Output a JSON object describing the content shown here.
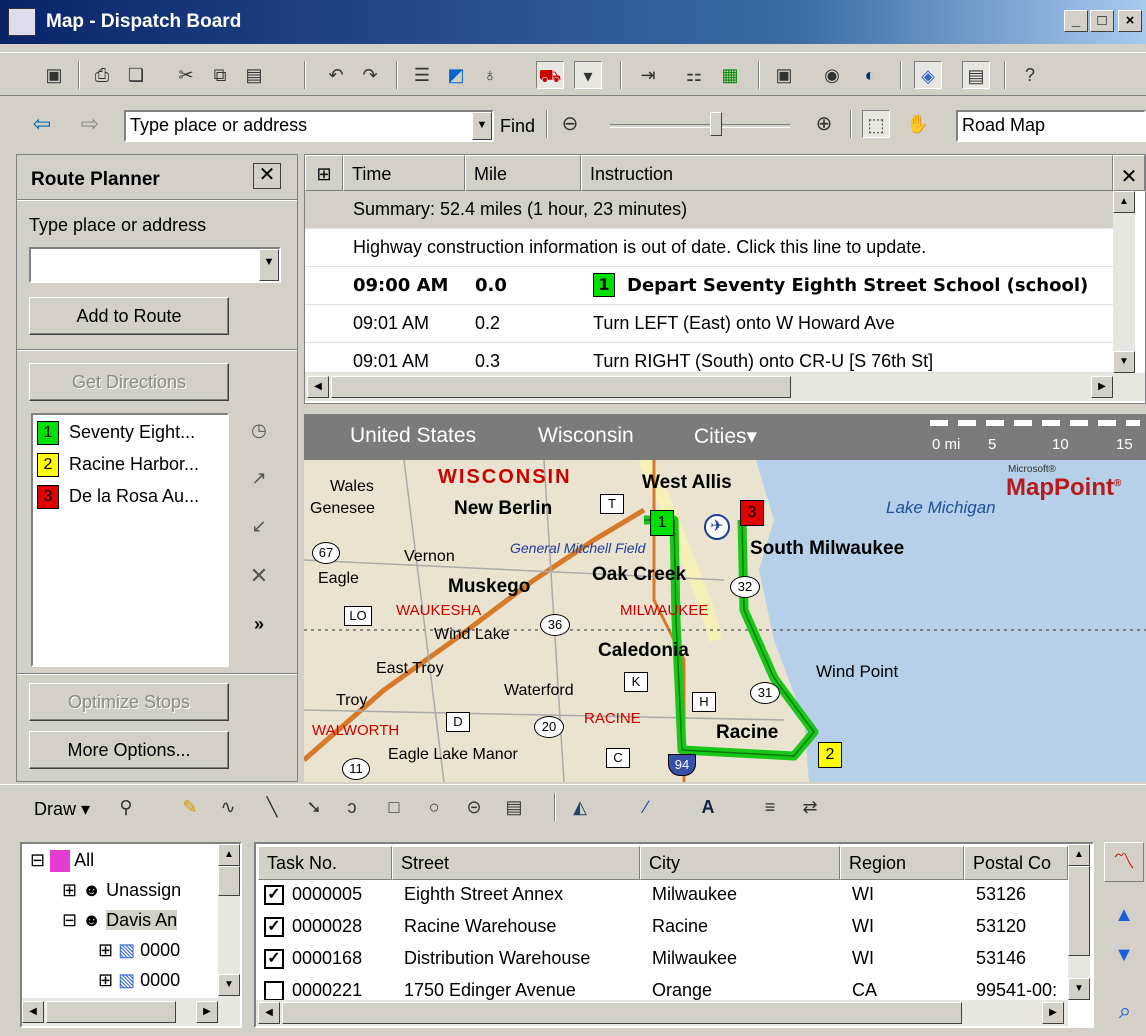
{
  "window": {
    "title": "Map - Dispatch Board"
  },
  "nav": {
    "search_value": "Type place or address",
    "find_label": "Find",
    "map_style": "Road Map"
  },
  "route_planner": {
    "title": "Route Planner",
    "input_label": "Type place or address",
    "input_value": "",
    "add_button": "Add to Route",
    "get_directions": "Get Directions",
    "optimize": "Optimize Stops",
    "more_options": "More Options...",
    "stops": [
      {
        "num": "1",
        "name": "Seventy Eight...",
        "color": "#00e000"
      },
      {
        "num": "2",
        "name": "Racine Harbor...",
        "color": "#ffff00"
      },
      {
        "num": "3",
        "name": "De la Rosa Au...",
        "color": "#e00000"
      }
    ]
  },
  "directions": {
    "headers": {
      "time": "Time",
      "mile": "Mile",
      "instruction": "Instruction"
    },
    "summary": "Summary:  52.4 miles (1 hour, 23 minutes)",
    "notice": "Highway construction information is out of date.  Click this line to update.",
    "rows": [
      {
        "time": "09:00 AM",
        "mile": "0.0",
        "badge": "1",
        "instruction": "Depart Seventy Eighth Street School (school)"
      },
      {
        "time": "09:01 AM",
        "mile": "0.2",
        "instruction": "Turn LEFT (East) onto W Howard Ave"
      },
      {
        "time": "09:01 AM",
        "mile": "0.3",
        "instruction": "Turn RIGHT (South) onto CR-U [S 76th St]"
      }
    ]
  },
  "map": {
    "breadcrumb": [
      "United States",
      "Wisconsin",
      "Cities▾"
    ],
    "scale": [
      "0 mi",
      "5",
      "10",
      "15"
    ],
    "brand_small": "Microsoft®",
    "brand": "MapPoint",
    "brand_mark": "®",
    "labels": {
      "wisconsin": "WISCONSIN",
      "wales": "Wales",
      "genesee": "Genesee",
      "new_berlin": "New Berlin",
      "west_allis": "West Allis",
      "lake_michigan": "Lake Michigan",
      "gmf": "General Mitchell Field",
      "south_milwaukee": "South Milwaukee",
      "vernon": "Vernon",
      "oak_creek": "Oak Creek",
      "eagle": "Eagle",
      "muskego": "Muskego",
      "waukesha": "WAUKESHA",
      "milwaukee": "MILWAUKEE",
      "wind_lake": "Wind Lake",
      "caledonia": "Caledonia",
      "east_troy": "East Troy",
      "wind_point": "Wind Point",
      "troy": "Troy",
      "waterford": "Waterford",
      "walworth": "WALWORTH",
      "racine_county": "RACINE",
      "racine": "Racine",
      "eagle_lake": "Eagle Lake Manor"
    },
    "shields": {
      "s67": "67",
      "lo": "LO",
      "s36": "36",
      "s32": "32",
      "k": "K",
      "h": "H",
      "s31": "31",
      "d": "D",
      "s20": "20",
      "c": "C",
      "s11": "11",
      "s94": "94",
      "t": "T"
    },
    "pins": {
      "p1": "1",
      "p2": "2",
      "p3": "3"
    }
  },
  "draw_toolbar": {
    "draw_label": "Draw"
  },
  "tree": {
    "items": [
      {
        "label": "All"
      },
      {
        "label": "Unassign"
      },
      {
        "label": "Davis An"
      },
      {
        "label": "0000"
      },
      {
        "label": "0000"
      }
    ]
  },
  "grid": {
    "headers": [
      "Task No.",
      "Street",
      "City",
      "Region",
      "Postal Co"
    ],
    "rows": [
      {
        "checked": true,
        "task": "0000005",
        "street": "Eighth Street Annex",
        "city": "Milwaukee",
        "region": "WI",
        "postal": "53126"
      },
      {
        "checked": true,
        "task": "0000028",
        "street": "Racine Warehouse",
        "city": "Racine",
        "region": "WI",
        "postal": "53120"
      },
      {
        "checked": true,
        "task": "0000168",
        "street": "Distribution Warehouse",
        "city": "Milwaukee",
        "region": "WI",
        "postal": "53146"
      },
      {
        "checked": false,
        "task": "0000221",
        "street": "1750 Edinger Avenue",
        "city": "Orange",
        "region": "CA",
        "postal": "99541-00:"
      }
    ]
  }
}
